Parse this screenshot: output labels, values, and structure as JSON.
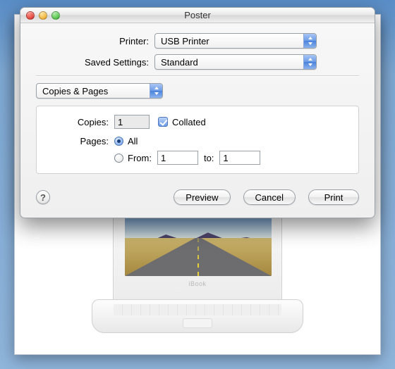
{
  "window": {
    "title": "Poster"
  },
  "printer_row": {
    "label": "Printer:",
    "value": "USB Printer"
  },
  "settings_row": {
    "label": "Saved Settings:",
    "value": "Standard"
  },
  "section": {
    "value": "Copies & Pages"
  },
  "copies": {
    "label": "Copies:",
    "value": "1",
    "collated_label": "Collated",
    "collated_checked": true
  },
  "pages": {
    "label": "Pages:",
    "all_label": "All",
    "all_selected": true,
    "from_label": "From:",
    "from_value": "1",
    "to_label": "to:",
    "to_value": "1"
  },
  "footer": {
    "help": "?",
    "preview": "Preview",
    "cancel": "Cancel",
    "print": "Print"
  },
  "ibook": {
    "brand": "iBook"
  }
}
